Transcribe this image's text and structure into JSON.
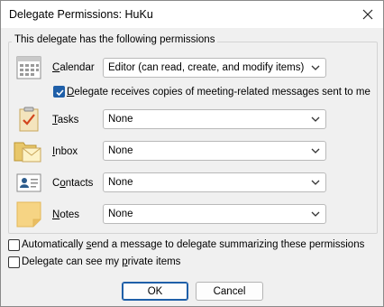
{
  "window": {
    "title": "Delegate Permissions: HuKu"
  },
  "group_title": "This delegate has the following permissions",
  "rows": [
    {
      "icon": "calendar-icon",
      "label_pre": "",
      "label_key": "C",
      "label_post": "alendar",
      "value": "Editor (can read, create, and modify items)"
    },
    {
      "icon": "tasks-icon",
      "label_pre": "",
      "label_key": "T",
      "label_post": "asks",
      "value": "None"
    },
    {
      "icon": "inbox-icon",
      "label_pre": "",
      "label_key": "I",
      "label_post": "nbox",
      "value": "None"
    },
    {
      "icon": "contacts-icon",
      "label_pre": "C",
      "label_key": "o",
      "label_post": "ntacts",
      "value": "None"
    },
    {
      "icon": "notes-icon",
      "label_pre": "",
      "label_key": "N",
      "label_post": "otes",
      "value": "None"
    }
  ],
  "meeting_copies": {
    "pre": "",
    "key": "D",
    "post": "elegate receives copies of meeting-related messages sent to me",
    "checked": true
  },
  "auto_send": {
    "pre": "Automatically ",
    "key": "s",
    "post": "end a message to delegate summarizing these permissions",
    "checked": false
  },
  "private_items": {
    "pre": "Delegate can see my ",
    "key": "p",
    "post": "rivate items",
    "checked": false
  },
  "buttons": {
    "ok": "OK",
    "cancel": "Cancel"
  },
  "colors": {
    "accent": "#1f5fa8",
    "background": "#f0f0f0"
  }
}
